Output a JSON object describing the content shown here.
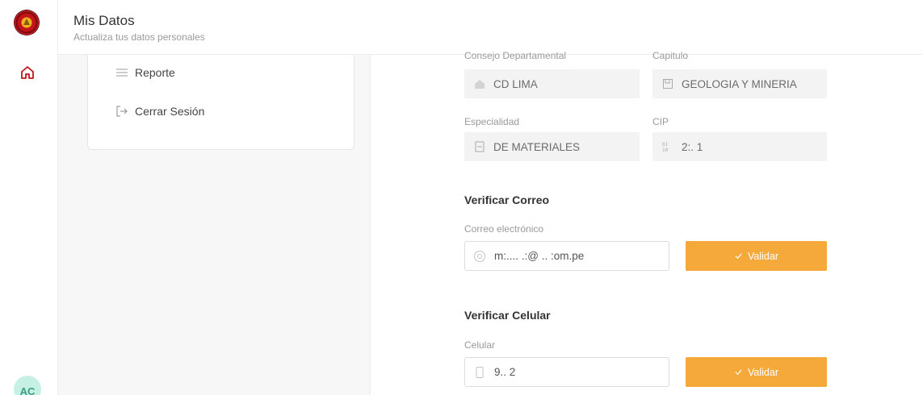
{
  "header": {
    "title": "Mis Datos",
    "subtitle": "Actualiza tus datos personales"
  },
  "sidebar": {
    "avatar_initials": "AC"
  },
  "menu": {
    "items": [
      {
        "label": "Reporte",
        "icon": "list-icon"
      },
      {
        "label": "Cerrar Sesión",
        "icon": "logout-icon"
      }
    ]
  },
  "form": {
    "consejo": {
      "label": "Consejo Departamental",
      "value": "CD LIMA",
      "icon": "building-icon"
    },
    "capitulo": {
      "label": "Capitulo",
      "value": "GEOLOGIA Y MINERIA",
      "icon": "bookmark-icon"
    },
    "especialidad": {
      "label": "Especialidad",
      "value": "DE MATERIALES",
      "icon": "document-icon"
    },
    "cip": {
      "label": "CIP",
      "value": "2:. 1",
      "icon": "number-icon"
    },
    "verify_email": {
      "title": "Verificar Correo",
      "label": "Correo electrónico",
      "value": "m:.... .:@ .. :om.pe",
      "button": "Validar"
    },
    "verify_phone": {
      "title": "Verificar Celular",
      "label": "Celular",
      "value": "9.. 2",
      "button": "Validar"
    }
  },
  "colors": {
    "accent": "#f5a93b",
    "brand_red": "#c2141a",
    "avatar_bg": "#c5f0e3"
  }
}
